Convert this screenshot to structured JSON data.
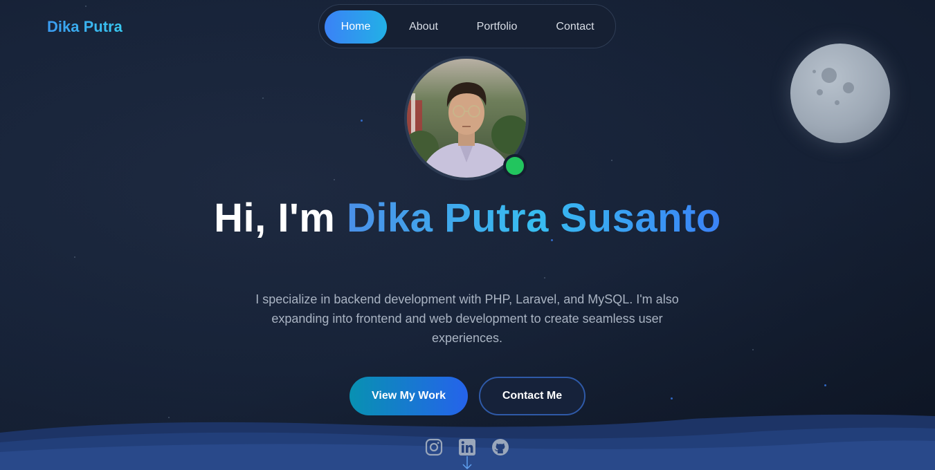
{
  "header": {
    "brand": "Dika Putra",
    "nav": [
      {
        "label": "Home",
        "active": true
      },
      {
        "label": "About",
        "active": false
      },
      {
        "label": "Portfolio",
        "active": false
      },
      {
        "label": "Contact",
        "active": false
      }
    ]
  },
  "hero": {
    "greeting": "Hi, I'm ",
    "name": "Dika Putra Susanto",
    "description": "I specialize in backend development with PHP, Laravel, and MySQL. I'm also expanding into frontend and web development to create seamless user experiences.",
    "primary_button": "View My Work",
    "secondary_button": "Contact Me",
    "status": "online"
  },
  "social": [
    {
      "icon": "instagram-icon"
    },
    {
      "icon": "linkedin-icon"
    },
    {
      "icon": "github-icon"
    }
  ],
  "colors": {
    "accent_start": "#3b82f6",
    "accent_end": "#22b0e6",
    "status_online": "#22c55e",
    "background": "#18243a"
  }
}
